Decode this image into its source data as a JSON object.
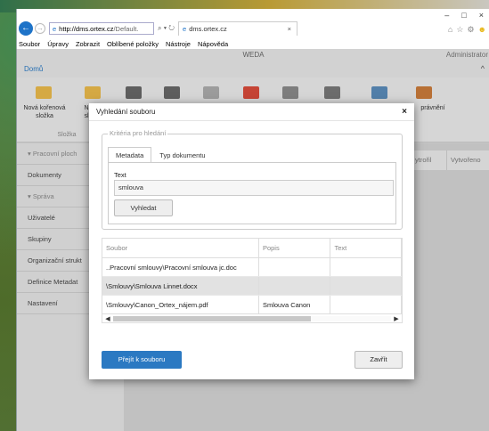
{
  "browser": {
    "address_host": "http://dms.ortex.cz",
    "address_rest": "/Default.",
    "address_icons": "⌕ ▾ ↻",
    "tab_title": "dms.ortex.cz",
    "tab_close": "×",
    "window_controls": [
      "–",
      "□",
      "×"
    ],
    "back_glyph": "←",
    "forward_glyph": "→",
    "ie_glyph": "e",
    "menu": [
      "Soubor",
      "Úpravy",
      "Zobrazit",
      "Oblíbené položky",
      "Nástroje",
      "Nápověda"
    ]
  },
  "app": {
    "title": "WEDA",
    "user": "Administrator",
    "home_tab": "Domů",
    "ribbon": {
      "new_root_folder": "Nová kořenová\nsložka",
      "new_partial": "N\nsl",
      "group_label": "Složka",
      "right_label": "právnění"
    },
    "sidebar": [
      {
        "label": "Pracovní ploch",
        "section": true
      },
      {
        "label": "Dokumenty",
        "section": false
      },
      {
        "label": "Správa",
        "section": true
      },
      {
        "label": "Uživatelé",
        "section": false
      },
      {
        "label": "Skupiny",
        "section": false
      },
      {
        "label": "Organizační strukt",
        "section": false
      },
      {
        "label": "Definice Metadat",
        "section": false
      },
      {
        "label": "Nastavení",
        "section": false
      }
    ],
    "columns_right": [
      "ytrořil",
      "Vytvořeno"
    ]
  },
  "dialog": {
    "title": "Vyhledání souboru",
    "close_glyph": "×",
    "legend": "Kritéria pro hledání",
    "tabs": [
      "Metadata",
      "Typ dokumentu"
    ],
    "text_label": "Text",
    "text_value": "smlouva",
    "search_button": "Vyhledat",
    "columns": [
      "Soubor",
      "Popis",
      "Text"
    ],
    "rows": [
      {
        "file": "..Pracovní smlouvy\\Pracovní smlouva jc.doc",
        "desc": "",
        "text": ""
      },
      {
        "file": "\\Smlouvy\\Smlouva Linnet.docx",
        "desc": "",
        "text": ""
      },
      {
        "file": "\\Smlouvy\\Canon_Ortex_nájem.pdf",
        "desc": "Smlouva Canon",
        "text": ""
      }
    ],
    "go_button": "Přejít k souboru",
    "close_button": "Zavřít"
  }
}
